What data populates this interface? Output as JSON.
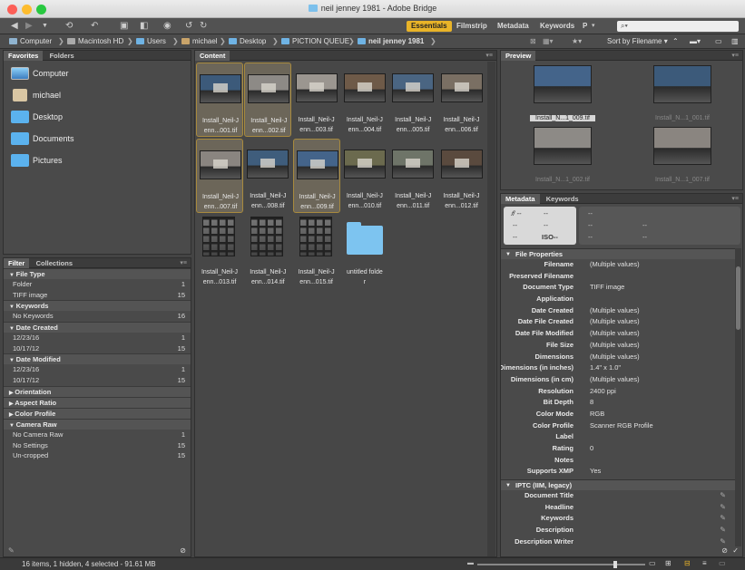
{
  "window": {
    "title": "neil jenney 1981 - Adobe Bridge"
  },
  "workspaces": [
    "Essentials",
    "Filmstrip",
    "Metadata",
    "Keywords",
    "P"
  ],
  "search": {
    "placeholder": "⌕▾"
  },
  "path": [
    "Computer",
    "Macintosh HD",
    "Users",
    "michael",
    "Desktop",
    "PICTION QUEUE",
    "neil jenney 1981"
  ],
  "sort": {
    "label": "Sort by Filename"
  },
  "left_tabs": [
    "Favorites",
    "Folders"
  ],
  "favorites": [
    {
      "label": "Computer",
      "icon": "computer-icon"
    },
    {
      "label": "michael",
      "icon": "home-icon"
    },
    {
      "label": "Desktop",
      "icon": "folder-icon"
    },
    {
      "label": "Documents",
      "icon": "folder-icon"
    },
    {
      "label": "Pictures",
      "icon": "folder-icon"
    }
  ],
  "filter_tabs": [
    "Filter",
    "Collections"
  ],
  "filter_groups": [
    {
      "title": "File Type",
      "open": true,
      "rows": [
        {
          "label": "Folder",
          "count": "1"
        },
        {
          "label": "TIFF image",
          "count": "15"
        }
      ]
    },
    {
      "title": "Keywords",
      "open": true,
      "rows": [
        {
          "label": "No Keywords",
          "count": "16"
        }
      ]
    },
    {
      "title": "Date Created",
      "open": true,
      "rows": [
        {
          "label": "12/23/16",
          "count": "1"
        },
        {
          "label": "10/17/12",
          "count": "15"
        }
      ]
    },
    {
      "title": "Date Modified",
      "open": true,
      "rows": [
        {
          "label": "12/23/16",
          "count": "1"
        },
        {
          "label": "10/17/12",
          "count": "15"
        }
      ]
    },
    {
      "title": "Orientation",
      "open": false,
      "rows": []
    },
    {
      "title": "Aspect Ratio",
      "open": false,
      "rows": []
    },
    {
      "title": "Color Profile",
      "open": false,
      "rows": []
    },
    {
      "title": "Camera Raw",
      "open": true,
      "rows": [
        {
          "label": "No Camera Raw",
          "count": "1"
        },
        {
          "label": "No Settings",
          "count": "15"
        },
        {
          "label": "Un-cropped",
          "count": "15"
        }
      ]
    }
  ],
  "content": {
    "tab": "Content",
    "items": [
      {
        "name": "Install_Neil-Jenn...001.tif",
        "l1": "Install_Neil-J",
        "l2": "enn...001.tif",
        "selected": true,
        "kind": "photo",
        "tone": "#3c5a7a"
      },
      {
        "name": "Install_Neil-Jenn...002.tif",
        "l1": "Install_Neil-J",
        "l2": "enn...002.tif",
        "selected": true,
        "kind": "photo",
        "tone": "#8d8a86"
      },
      {
        "name": "Install_Neil-Jenn...003.tif",
        "l1": "Install_Neil-J",
        "l2": "enn...003.tif",
        "selected": false,
        "kind": "photo",
        "tone": "#9b9690"
      },
      {
        "name": "Install_Neil-Jenn...004.tif",
        "l1": "Install_Neil-J",
        "l2": "enn...004.tif",
        "selected": false,
        "kind": "photo",
        "tone": "#6e5a48"
      },
      {
        "name": "Install_Neil-Jenn...005.tif",
        "l1": "Install_Neil-J",
        "l2": "enn...005.tif",
        "selected": false,
        "kind": "photo",
        "tone": "#4a6582"
      },
      {
        "name": "Install_Neil-Jenn...006.tif",
        "l1": "Install_Neil-J",
        "l2": "enn...006.tif",
        "selected": false,
        "kind": "photo",
        "tone": "#7a6f63"
      },
      {
        "name": "Install_Neil-Jenn...007.tif",
        "l1": "Install_Neil-J",
        "l2": "enn...007.tif",
        "selected": true,
        "kind": "photo",
        "tone": "#8a8580"
      },
      {
        "name": "Install_Neil-Jenn...008.tif",
        "l1": "Install_Neil-J",
        "l2": "enn...008.tif",
        "selected": false,
        "kind": "photo",
        "tone": "#3f5d7c"
      },
      {
        "name": "Install_Neil-Jenn...009.tif",
        "l1": "Install_Neil-J",
        "l2": "enn...009.tif",
        "selected": true,
        "kind": "photo",
        "tone": "#44648a"
      },
      {
        "name": "Install_Neil-Jenn...010.tif",
        "l1": "Install_Neil-J",
        "l2": "enn...010.tif",
        "selected": false,
        "kind": "photo",
        "tone": "#6b6a4e"
      },
      {
        "name": "Install_Neil-Jenn...011.tif",
        "l1": "Install_Neil-J",
        "l2": "enn...011.tif",
        "selected": false,
        "kind": "photo",
        "tone": "#6e7468"
      },
      {
        "name": "Install_Neil-Jenn...012.tif",
        "l1": "Install_Neil-J",
        "l2": "enn...012.tif",
        "selected": false,
        "kind": "photo",
        "tone": "#5a4a3e"
      },
      {
        "name": "Install_Neil-Jenn...013.tif",
        "l1": "Install_Neil-J",
        "l2": "enn...013.tif",
        "selected": false,
        "kind": "contact",
        "tone": "#111111"
      },
      {
        "name": "Install_Neil-Jenn...014.tif",
        "l1": "Install_Neil-J",
        "l2": "enn...014.tif",
        "selected": false,
        "kind": "contact",
        "tone": "#111111"
      },
      {
        "name": "Install_Neil-Jenn...015.tif",
        "l1": "Install_Neil-J",
        "l2": "enn...015.tif",
        "selected": false,
        "kind": "contact",
        "tone": "#111111"
      },
      {
        "name": "untitled folder",
        "l1": "untitled folde",
        "l2": "r",
        "selected": false,
        "kind": "folder",
        "tone": "#7dc4f0"
      }
    ]
  },
  "preview": {
    "tab": "Preview",
    "items": [
      {
        "label": "Install_N...1_009.tif",
        "dim": false,
        "tone": "#44648a"
      },
      {
        "label": "Install_N...1_001.tif",
        "dim": true,
        "tone": "#3c5a7a"
      },
      {
        "label": "Install_N...1_002.tif",
        "dim": true,
        "tone": "#8d8a86"
      },
      {
        "label": "Install_N...1_007.tif",
        "dim": true,
        "tone": "#8a8580"
      }
    ]
  },
  "metadata_tabs": [
    "Metadata",
    "Keywords"
  ],
  "camera": {
    "fstop": "𝑓/ --",
    "shutter": "--",
    "c1": "--",
    "c2": "--",
    "c3": "--",
    "iso": "ISO--",
    "r1": "--",
    "r2": "--",
    "r3": "--",
    "r4": "--",
    "r5": "--"
  },
  "file_properties": {
    "title": "File Properties",
    "rows": [
      {
        "k": "Filename",
        "v": "(Multiple values)"
      },
      {
        "k": "Preserved Filename",
        "v": ""
      },
      {
        "k": "Document Type",
        "v": "TIFF image"
      },
      {
        "k": "Application",
        "v": ""
      },
      {
        "k": "Date Created",
        "v": "(Multiple values)"
      },
      {
        "k": "Date File Created",
        "v": "(Multiple values)"
      },
      {
        "k": "Date File Modified",
        "v": "(Multiple values)"
      },
      {
        "k": "File Size",
        "v": "(Multiple values)"
      },
      {
        "k": "Dimensions",
        "v": "(Multiple values)"
      },
      {
        "k": "Dimensions (in inches)",
        "v": "1.4\" x 1.0\""
      },
      {
        "k": "Dimensions (in cm)",
        "v": "(Multiple values)"
      },
      {
        "k": "Resolution",
        "v": "2400 ppi"
      },
      {
        "k": "Bit Depth",
        "v": "8"
      },
      {
        "k": "Color Mode",
        "v": "RGB"
      },
      {
        "k": "Color Profile",
        "v": "Scanner RGB Profile"
      },
      {
        "k": "Label",
        "v": ""
      },
      {
        "k": "Rating",
        "v": "0"
      },
      {
        "k": "Notes",
        "v": ""
      },
      {
        "k": "Supports XMP",
        "v": "Yes"
      }
    ]
  },
  "iptc": {
    "title": "IPTC (IIM, legacy)",
    "rows": [
      {
        "k": "Document Title"
      },
      {
        "k": "Headline"
      },
      {
        "k": "Keywords"
      },
      {
        "k": "Description"
      },
      {
        "k": "Description Writer"
      }
    ]
  },
  "status": {
    "text": "16 items, 1 hidden, 4 selected - 91.61 MB"
  },
  "colors": {
    "accent": "#e9b428",
    "selection_border": "#a88a3e"
  }
}
